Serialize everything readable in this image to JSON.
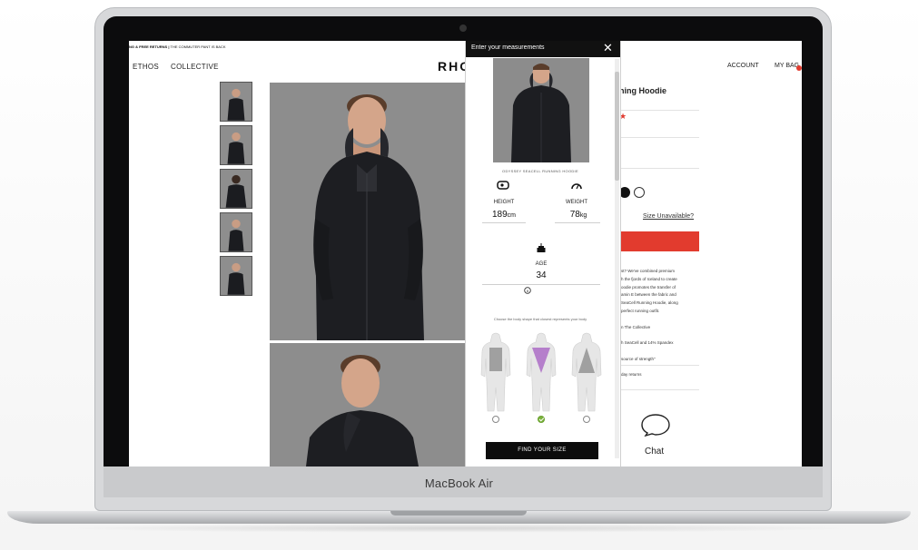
{
  "device": {
    "brand_label": "MacBook Air"
  },
  "site": {
    "promo_text_bold": "NG & FREE RETURNS |",
    "promo_text": "THE COMMUTER PANT IS BACK",
    "nav": [
      "ETHOS",
      "COLLECTIVE"
    ],
    "logo": "RHO",
    "header_right": {
      "account": "ACCOUNT",
      "bag": "MY BAG"
    }
  },
  "product": {
    "title_partial": "ning Hoodie",
    "size_unavailable_link": "Size Unavailable?",
    "description_lines": [
      "st? We've combined premium",
      "h the fjords of Iceland to create",
      "oodie promotes the transfer of",
      "amin E between the fabric and",
      "SeaCell Running Hoodie, along",
      "perfect running outfit.",
      "",
      "n The Collective",
      "",
      "h SeaCell and 14% Spandex",
      "",
      "source of strength\"",
      "",
      "day returns"
    ],
    "chat_label": "Chat",
    "accent_color": "#e23b2e"
  },
  "modal": {
    "title": "Enter your measurements",
    "close_label": "✕",
    "product_name": "ODYSSEY SEACELL RUNNING HOODIE",
    "height": {
      "label": "HEIGHT",
      "value": "189",
      "unit": "cm"
    },
    "weight": {
      "label": "WEIGHT",
      "value": "78",
      "unit": "kg"
    },
    "age": {
      "label": "AGE",
      "value": "34"
    },
    "body_shape_hint": "Choose the body shape that closest represents your body",
    "body_shapes": [
      {
        "name": "rectangle",
        "selected": false
      },
      {
        "name": "inverted-triangle",
        "selected": true
      },
      {
        "name": "triangle",
        "selected": false
      }
    ],
    "cta": "FIND YOUR SIZE"
  }
}
